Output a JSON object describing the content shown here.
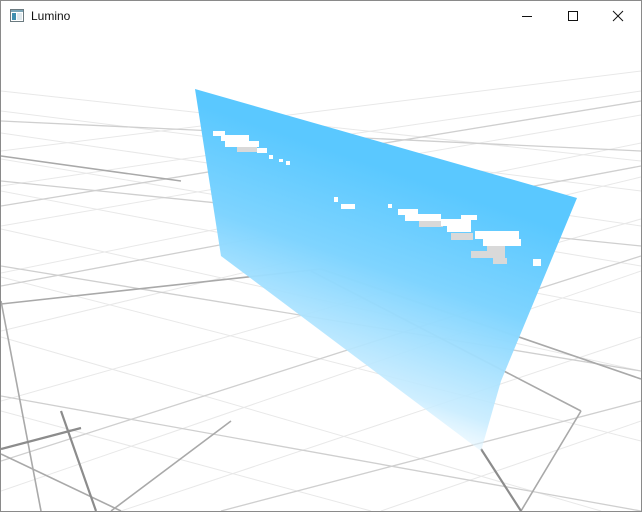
{
  "window": {
    "title": "Lumino",
    "icon": "app-window-icon",
    "controls": {
      "minimize_icon": "minimize-icon",
      "maximize_icon": "maximize-icon",
      "close_icon": "close-icon"
    }
  },
  "scene": {
    "background_color": "#ffffff",
    "grid_minor_color": "#e6e6e6",
    "grid_major_color": "#b0b0b0",
    "sky_color": "#5ac8ff",
    "cloud_color": "#ffffff",
    "cloud_shadow_color": "#d9d9d9"
  }
}
